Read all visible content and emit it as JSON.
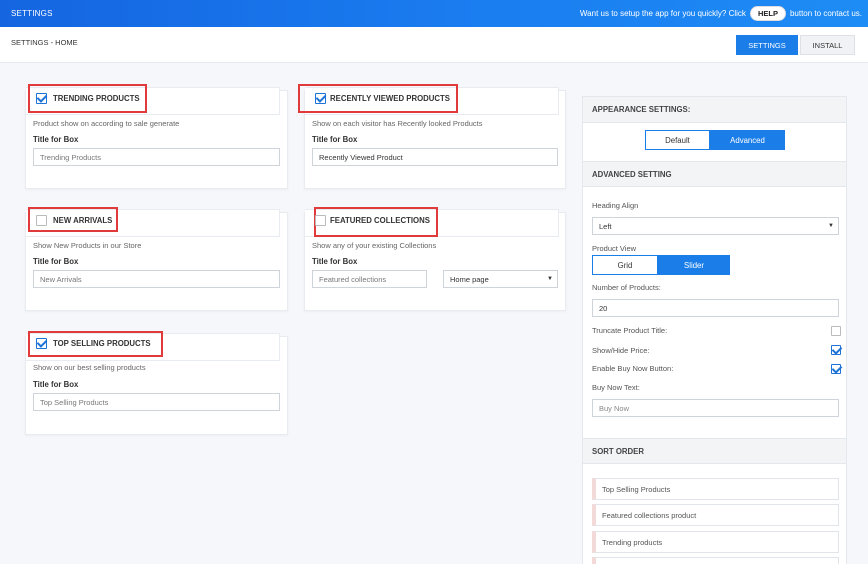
{
  "topbar": {
    "title": "SETTINGS",
    "help_text_before": "Want us to setup the app for you quickly? Click",
    "help_button": "HELP",
    "help_text_after": "button to contact us."
  },
  "subheader": {
    "breadcrumb": "SETTINGS - HOME",
    "tabs": [
      "SETTINGS",
      "INSTALL"
    ]
  },
  "cards": {
    "trending": {
      "title": "TRENDING PRODUCTS",
      "checked": true,
      "desc": "Product show on according to sale generate",
      "field_label": "Title for Box",
      "placeholder": "Trending Products"
    },
    "recent": {
      "title": "RECENTLY VIEWED PRODUCTS",
      "checked": true,
      "desc": "Show on each visitor has Recently looked Products",
      "field_label": "Title for Box",
      "value": "Recently Viewed Product"
    },
    "new_arrivals": {
      "title": "NEW ARRIVALS",
      "checked": false,
      "desc": "Show New Products in our Store",
      "field_label": "Title for Box",
      "placeholder": "New Arrivals"
    },
    "featured": {
      "title": "FEATURED COLLECTIONS",
      "checked": false,
      "desc": "Show any of your existing Collections",
      "field_label": "Title for Box",
      "placeholder": "Featured collections",
      "select_value": "Home page"
    },
    "top_selling": {
      "title": "TOP SELLING PRODUCTS",
      "checked": true,
      "desc": "Show on our best selling products",
      "field_label": "Title for Box",
      "placeholder": "Top Selling Products"
    }
  },
  "appearance": {
    "title": "APPEARANCE SETTINGS:",
    "modes": [
      "Default",
      "Advanced"
    ],
    "active_mode": "Advanced"
  },
  "advanced": {
    "title": "ADVANCED SETTING",
    "heading_align_label": "Heading Align",
    "heading_align_value": "Left",
    "product_view_label": "Product View",
    "product_views": [
      "Grid",
      "Slider"
    ],
    "active_view": "Slider",
    "num_products_label": "Number of Products:",
    "num_products_value": "20",
    "truncate_label": "Truncate Product Title:",
    "truncate_checked": false,
    "show_price_label": "Show/Hide Price:",
    "show_price_checked": true,
    "buy_now_btn_label": "Enable Buy Now Button:",
    "buy_now_btn_checked": true,
    "buy_now_text_label": "Buy Now Text:",
    "buy_now_text_placeholder": "Buy Now"
  },
  "sort_order": {
    "title": "SORT ORDER",
    "items": [
      "Top Selling Products",
      "Featured collections product",
      "Trending products"
    ]
  },
  "colors": {
    "accent": "#1a7de8",
    "highlight": "#e03a3a"
  }
}
